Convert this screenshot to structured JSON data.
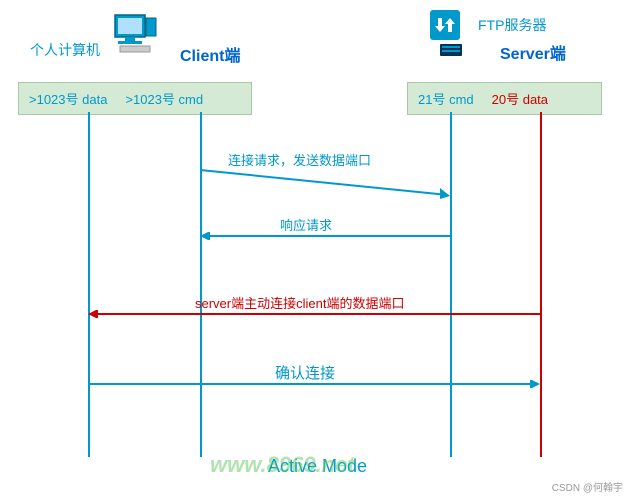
{
  "client": {
    "label": "个人计算机",
    "role": "Client端",
    "data_port": ">1023号 data",
    "cmd_port": ">1023号 cmd"
  },
  "server": {
    "label": "FTP服务器",
    "role": "Server端",
    "cmd_port": "21号 cmd",
    "data_port": "20号 data"
  },
  "messages": {
    "m1": "连接请求，发送数据端口",
    "m2": "响应请求",
    "m3": "server端主动连接client端的数据端口",
    "m4": "确认连接"
  },
  "title": "Active Mode",
  "watermark": "www.8969.net",
  "credit": "CSDN @何翰宇"
}
